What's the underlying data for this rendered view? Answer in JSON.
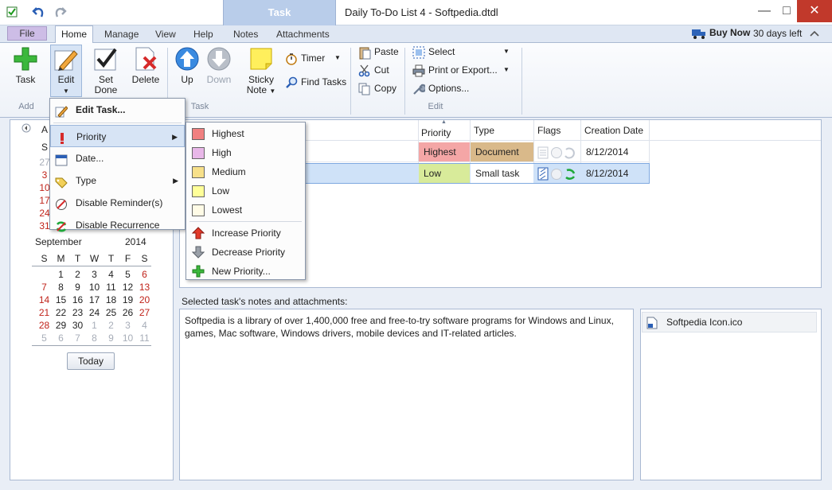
{
  "window": {
    "title": "Daily To-Do List 4 - Softpedia.dtdl",
    "context_tab": "Task",
    "buy_now": "Buy Now",
    "days_left": "30 days left"
  },
  "tabs": [
    "File",
    "Home",
    "Manage",
    "View",
    "Help",
    "Notes",
    "Attachments"
  ],
  "ribbon": {
    "task": "Task",
    "edit": "Edit",
    "set_done_1": "Set",
    "set_done_2": "Done",
    "delete": "Delete",
    "up": "Up",
    "down": "Down",
    "sticky_1": "Sticky",
    "sticky_2": "Note",
    "timer": "Timer",
    "find_tasks": "Find Tasks",
    "paste": "Paste",
    "cut": "Cut",
    "copy": "Copy",
    "select": "Select",
    "print_export": "Print or Export...",
    "options": "Options...",
    "group_add": "Add",
    "group_task": "Task",
    "group_edit": "Edit"
  },
  "edit_menu": {
    "edit_task": "Edit Task...",
    "priority": "Priority",
    "date": "Date...",
    "type": "Type",
    "disable_reminders": "Disable Reminder(s)",
    "disable_recurrence": "Disable Recurrence"
  },
  "priority_menu": {
    "items": [
      {
        "label": "Highest",
        "color": "#f08080"
      },
      {
        "label": "High",
        "color": "#e8b7e8"
      },
      {
        "label": "Medium",
        "color": "#f7e08a"
      },
      {
        "label": "Low",
        "color": "#ffff99"
      },
      {
        "label": "Lowest",
        "color": "#fffbe6"
      }
    ],
    "increase": "Increase Priority",
    "decrease": "Decrease Priority",
    "new": "New Priority..."
  },
  "calendar": {
    "prev_month_partial": "A",
    "prev_col_s": "S",
    "prev_days": [
      "27",
      "3",
      "10",
      "17",
      "24",
      "31"
    ],
    "month": "September",
    "year": "2014",
    "weekdays": [
      "S",
      "M",
      "T",
      "W",
      "T",
      "F",
      "S"
    ],
    "weeks": [
      [
        "",
        "1",
        "2",
        "3",
        "4",
        "5",
        "6"
      ],
      [
        "7",
        "8",
        "9",
        "10",
        "11",
        "12",
        "13"
      ],
      [
        "14",
        "15",
        "16",
        "17",
        "18",
        "19",
        "20"
      ],
      [
        "21",
        "22",
        "23",
        "24",
        "25",
        "26",
        "27"
      ],
      [
        "28",
        "29",
        "30",
        "1",
        "2",
        "3",
        "4"
      ],
      [
        "5",
        "6",
        "7",
        "8",
        "9",
        "10",
        "11"
      ]
    ],
    "today": "Today"
  },
  "grid": {
    "headers": {
      "priority": "Priority",
      "type": "Type",
      "flags": "Flags",
      "created": "Creation Date"
    },
    "rows": [
      {
        "priority": "Highest",
        "priority_color": "#f4a6a6",
        "type": "Document",
        "type_color": "#d9b98a",
        "created": "8/12/2014"
      },
      {
        "priority": "Low",
        "priority_color": "#d8eb9a",
        "type": "Small task",
        "type_color": "#ffffff",
        "created": "8/12/2014"
      }
    ]
  },
  "notes": {
    "label": "Selected task's notes and attachments:",
    "text": "Softpedia is a library of over 1,400,000 free and free-to-try software programs for Windows and Linux, games, Mac software, Windows drivers, mobile devices and IT-related articles.",
    "attachment": "Softpedia Icon.ico"
  }
}
